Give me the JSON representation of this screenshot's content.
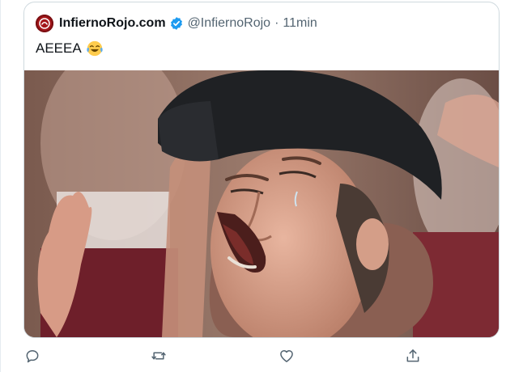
{
  "tweet": {
    "display_name": "InfiernoRojo.com",
    "handle": "@InfiernoRojo",
    "separator": "·",
    "time": "11min",
    "text": "AEEEA",
    "emoji": "face-with-tears-of-joy"
  },
  "media": {
    "type": "photo"
  },
  "actions": {
    "reply_icon": "reply-icon",
    "retweet_icon": "retweet-icon",
    "like_icon": "like-icon",
    "share_icon": "share-icon"
  },
  "colors": {
    "verified": "#1d9bf0",
    "secondary_text": "#536471",
    "action_icons": "#536471",
    "brand": "#a4161a"
  }
}
